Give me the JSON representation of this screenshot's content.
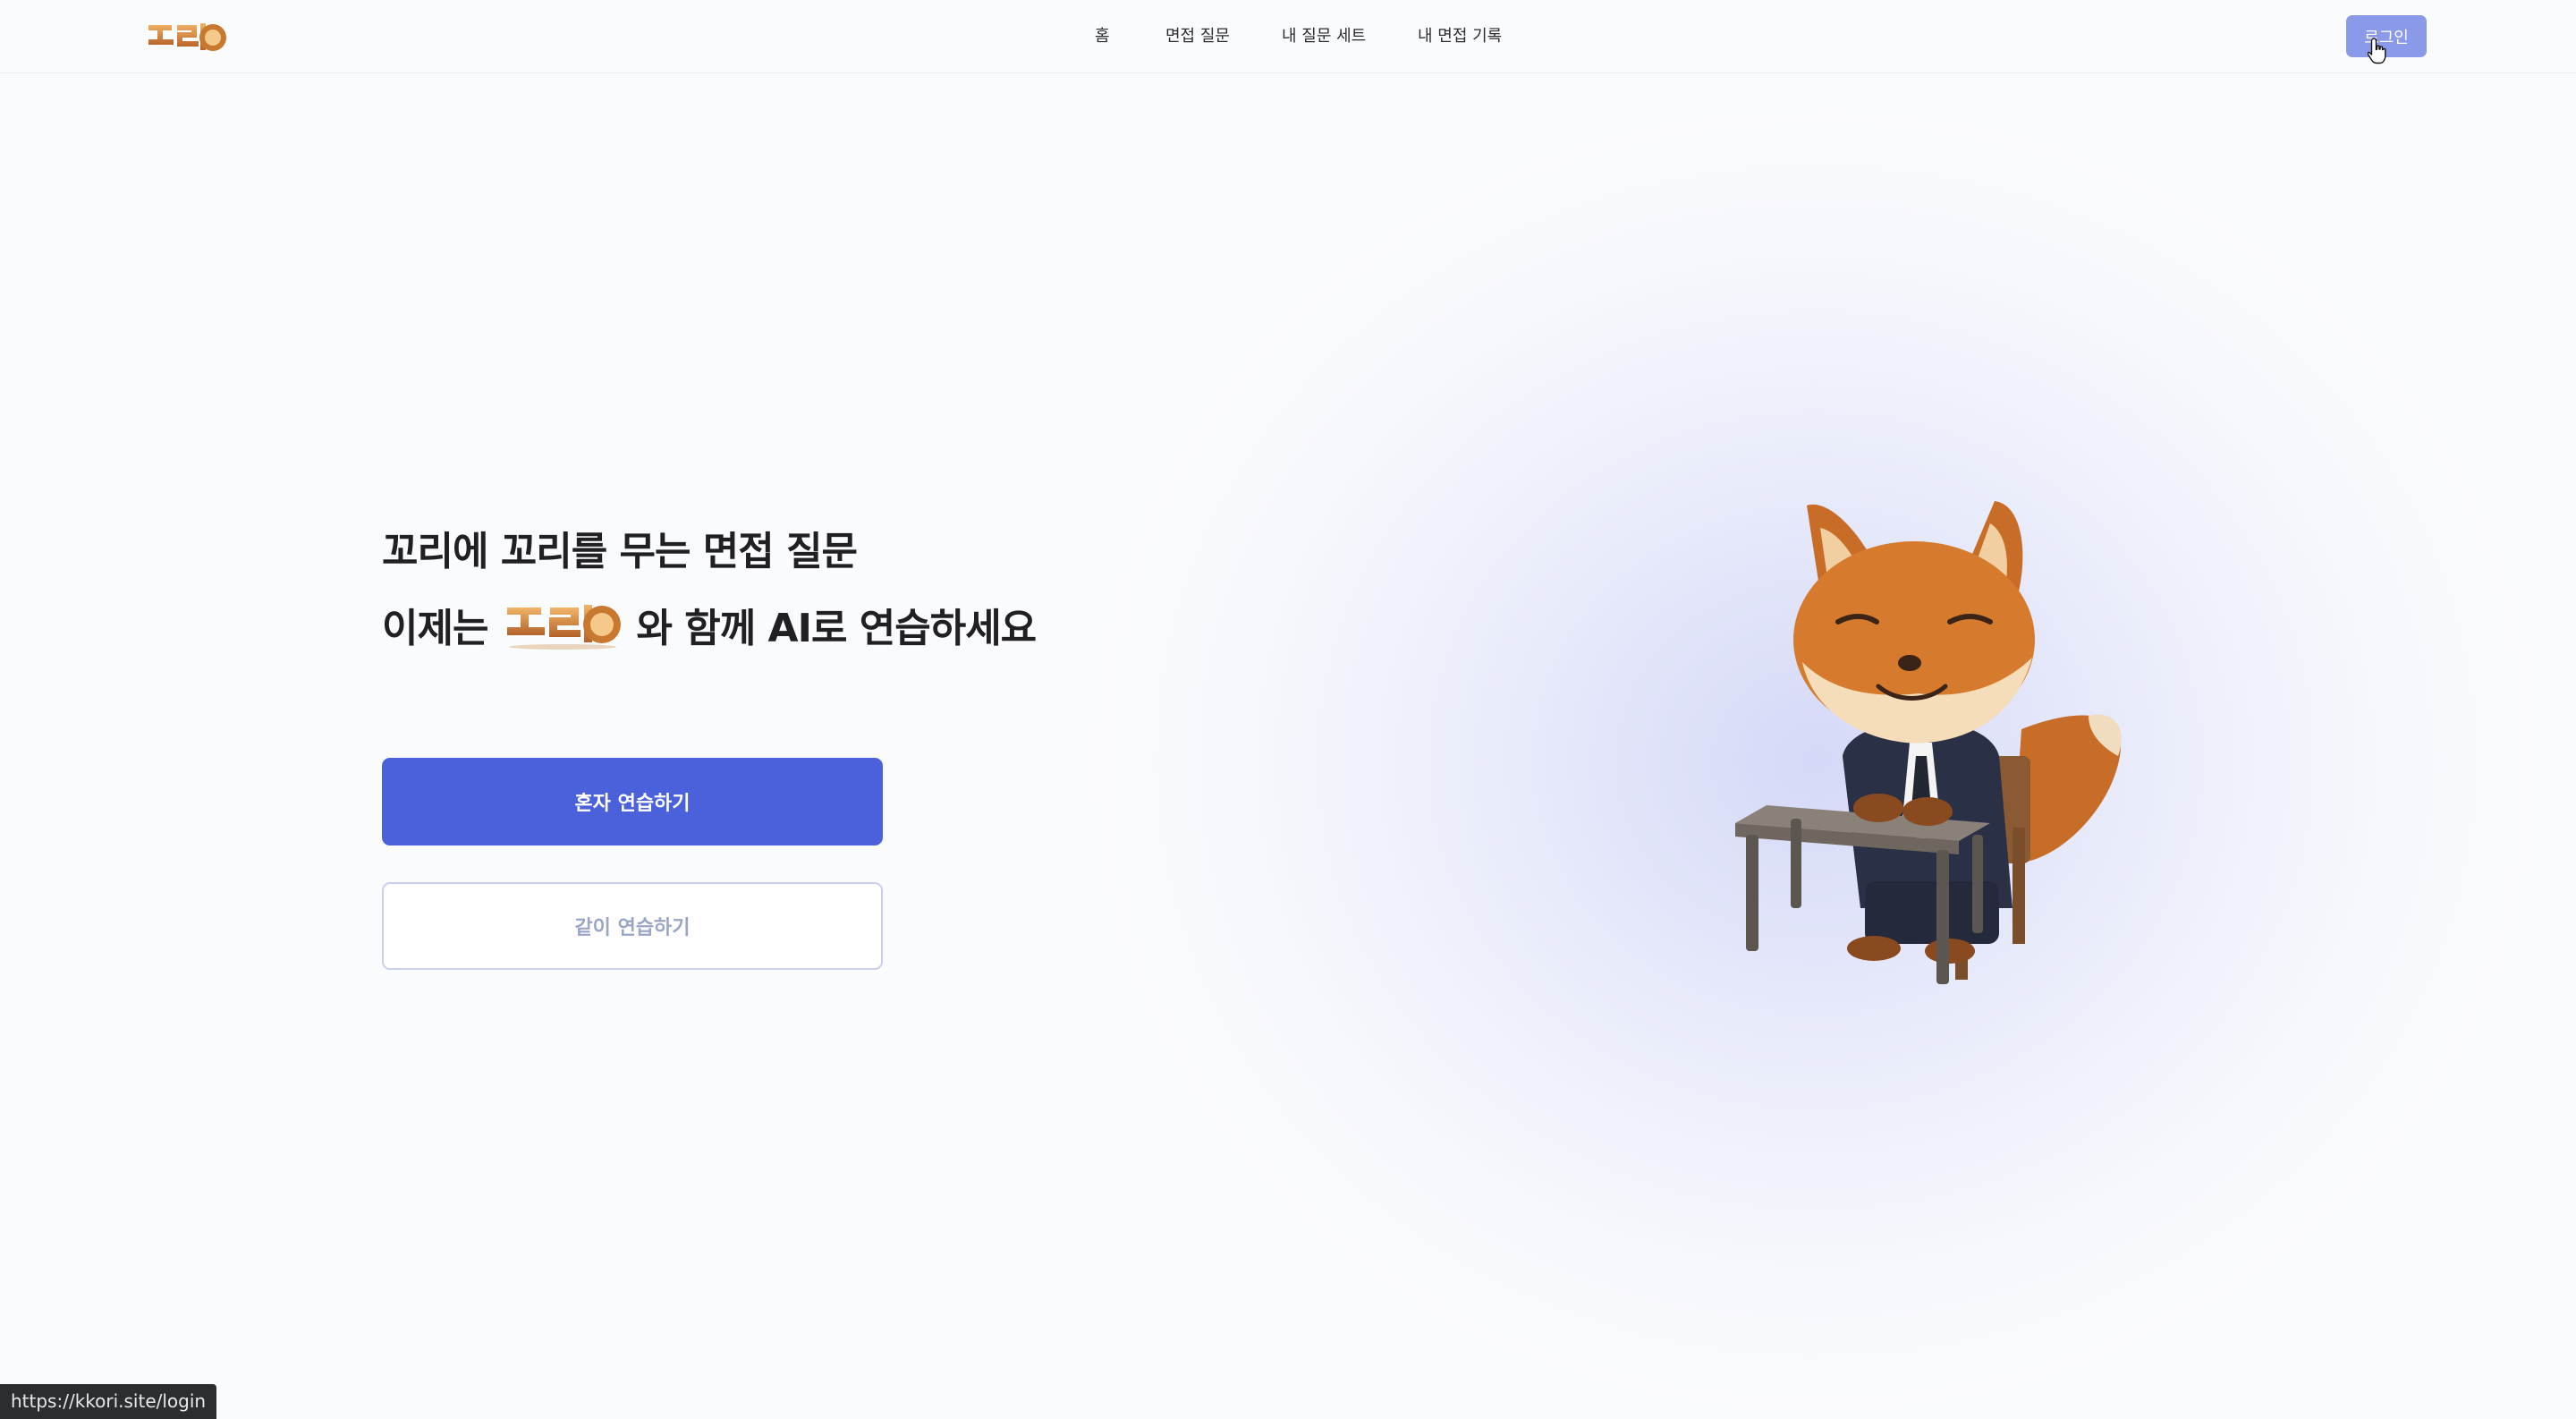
{
  "header": {
    "logo_text": "꼬리",
    "nav": [
      {
        "label": "홈"
      },
      {
        "label": "면접 질문"
      },
      {
        "label": "내 질문 세트"
      },
      {
        "label": "내 면접 기록"
      }
    ],
    "login_label": "로그인"
  },
  "hero": {
    "line1": "꼬리에 꼬리를 무는 면접 질문",
    "line2_prefix": "이제는",
    "wordmark_text": "꼬리",
    "line2_suffix": "와 함께 AI로 연습하세요"
  },
  "actions": {
    "solo_label": "혼자 연습하기",
    "group_label": "같이 연습하기"
  },
  "status_bar": {
    "url": "https://kkori.site/login"
  },
  "colors": {
    "primary": "#4a61db",
    "login_bg": "#8b9ae8",
    "logo_orange": "#d4893a"
  }
}
